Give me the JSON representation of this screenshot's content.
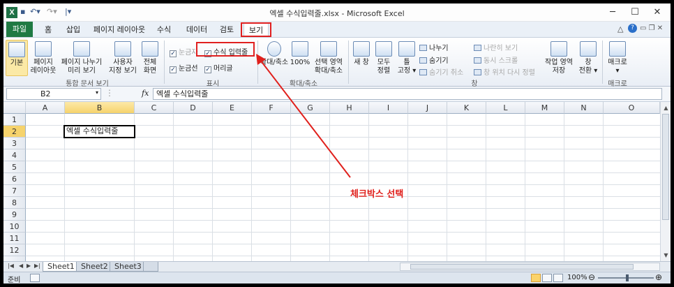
{
  "window": {
    "title": "엑셀 수식입력줄.xlsx - Microsoft Excel",
    "app_icon": "X",
    "qat_items": [
      "save-icon",
      "undo-icon",
      "redo-icon",
      "customize-icon"
    ],
    "buttons": [
      "─",
      "☐",
      "✕"
    ]
  },
  "ribbon_tabs": [
    "파일",
    "홈",
    "삽입",
    "페이지 레이아웃",
    "수식",
    "데이터",
    "검토",
    "보기"
  ],
  "active_tab": "보기",
  "ribbon": {
    "workbook_views": {
      "label": "통합 문서 보기",
      "buttons": [
        {
          "line1": "기본",
          "line2": ""
        },
        {
          "line1": "페이지",
          "line2": "레이아웃"
        },
        {
          "line1": "페이지 나누기",
          "line2": "미리 보기"
        },
        {
          "line1": "사용자",
          "line2": "지정 보기"
        },
        {
          "line1": "전체",
          "line2": "화면"
        }
      ]
    },
    "show": {
      "label": "표시",
      "checkboxes": [
        {
          "label": "눈금자",
          "checked": true,
          "enabled": false
        },
        {
          "label": "수식 입력줄",
          "checked": true,
          "enabled": true
        },
        {
          "label": "눈금선",
          "checked": true,
          "enabled": true
        },
        {
          "label": "머리글",
          "checked": true,
          "enabled": true
        }
      ]
    },
    "zoom": {
      "label": "확대/축소",
      "buttons": [
        {
          "line1": "확대/축소",
          "line2": ""
        },
        {
          "line1": "100%",
          "line2": ""
        },
        {
          "line1": "선택 영역",
          "line2": "확대/축소"
        }
      ]
    },
    "window": {
      "label": "창",
      "buttons": [
        {
          "line1": "새 창",
          "line2": ""
        },
        {
          "line1": "모두",
          "line2": "정렬"
        },
        {
          "line1": "틀",
          "line2": "고정 ▾"
        }
      ],
      "small": [
        {
          "label": "나누기",
          "enabled": true
        },
        {
          "label": "숨기기",
          "enabled": true
        },
        {
          "label": "숨기기 취소",
          "enabled": false
        },
        {
          "label": "나란히 보기",
          "enabled": false
        },
        {
          "label": "동시 스크롤",
          "enabled": false
        },
        {
          "label": "창 위치 다시 정렬",
          "enabled": false
        }
      ],
      "big_right": [
        {
          "line1": "작업 영역",
          "line2": "저장"
        },
        {
          "line1": "창",
          "line2": "전환 ▾"
        }
      ]
    },
    "macros": {
      "label": "매크로",
      "buttons": [
        {
          "line1": "매크로",
          "line2": "▾"
        }
      ]
    }
  },
  "formula_bar": {
    "name_box": "B2",
    "fx": "fx",
    "formula": "엑셀 수식입력줄"
  },
  "sheet": {
    "columns": [
      "A",
      "B",
      "C",
      "D",
      "E",
      "F",
      "G",
      "H",
      "I",
      "J",
      "K",
      "L",
      "M",
      "N",
      "O"
    ],
    "selected_column": "B",
    "rows": [
      "1",
      "2",
      "3",
      "4",
      "5",
      "6",
      "7",
      "8",
      "9",
      "10",
      "11",
      "12"
    ],
    "selected_row": "2",
    "active_cell": "B2",
    "active_cell_value": "엑셀 수식입력줄"
  },
  "sheet_tabs": [
    "Sheet1",
    "Sheet2",
    "Sheet3"
  ],
  "active_sheet": "Sheet1",
  "status": {
    "text": "준비",
    "zoom": "100%"
  },
  "annotation": {
    "text": "체크박스 선택",
    "color": "#e0201c"
  }
}
